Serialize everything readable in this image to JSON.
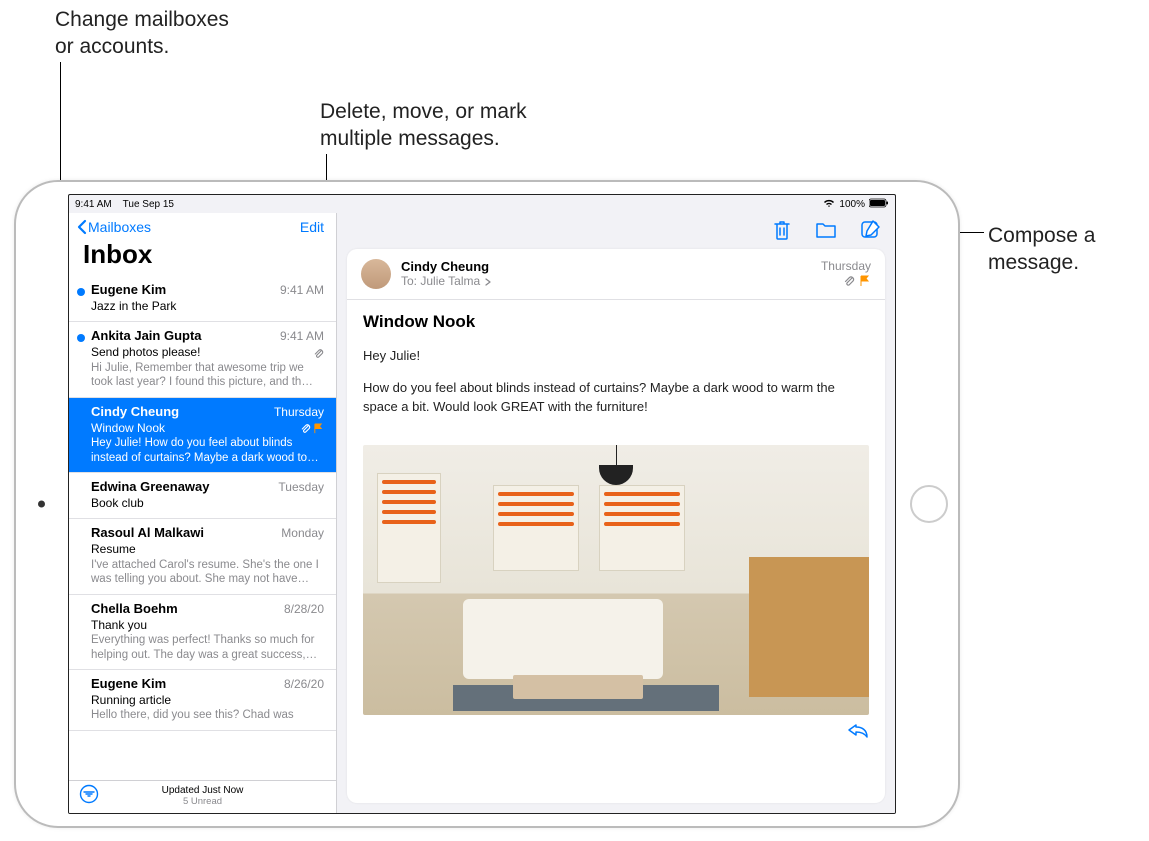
{
  "callouts": {
    "mailboxes": "Change mailboxes\nor accounts.",
    "edit": "Delete, move, or mark\nmultiple messages.",
    "compose": "Compose a\nmessage."
  },
  "status": {
    "time": "9:41 AM",
    "date": "Tue Sep 15",
    "wifi": "wifi",
    "battery_pct": "100%"
  },
  "sidebar": {
    "back_label": "Mailboxes",
    "edit_label": "Edit",
    "title": "Inbox",
    "items": [
      {
        "sender": "Eugene Kim",
        "date": "9:41 AM",
        "subject": "Jazz in the Park",
        "preview": "",
        "unread": true,
        "attachment": false,
        "flagged": false,
        "selected": false
      },
      {
        "sender": "Ankita Jain Gupta",
        "date": "9:41 AM",
        "subject": "Send photos please!",
        "preview": "Hi Julie, Remember that awesome trip we took last year? I found this picture, and th…",
        "unread": true,
        "attachment": true,
        "flagged": false,
        "selected": false
      },
      {
        "sender": "Cindy Cheung",
        "date": "Thursday",
        "subject": "Window Nook",
        "preview": "Hey Julie! How do you feel about blinds instead of curtains? Maybe a dark wood to…",
        "unread": false,
        "attachment": true,
        "flagged": true,
        "selected": true
      },
      {
        "sender": "Edwina Greenaway",
        "date": "Tuesday",
        "subject": "Book club",
        "preview": "",
        "unread": false,
        "attachment": false,
        "flagged": false,
        "selected": false
      },
      {
        "sender": "Rasoul Al Malkawi",
        "date": "Monday",
        "subject": "Resume",
        "preview": "I've attached Carol's resume. She's the one I was telling you about. She may not have…",
        "unread": false,
        "attachment": false,
        "flagged": false,
        "selected": false
      },
      {
        "sender": "Chella Boehm",
        "date": "8/28/20",
        "subject": "Thank you",
        "preview": "Everything was perfect! Thanks so much for helping out. The day was a great success,…",
        "unread": false,
        "attachment": false,
        "flagged": false,
        "selected": false
      },
      {
        "sender": "Eugene Kim",
        "date": "8/26/20",
        "subject": "Running article",
        "preview": "Hello there, did you see this? Chad was",
        "unread": false,
        "attachment": false,
        "flagged": false,
        "selected": false
      }
    ],
    "footer_status": "Updated Just Now",
    "footer_unread": "5 Unread"
  },
  "detail": {
    "from": "Cindy Cheung",
    "to_label": "To:",
    "to_name": "Julie Talma",
    "date": "Thursday",
    "attachment": true,
    "flagged": true,
    "subject": "Window Nook",
    "greeting": "Hey Julie!",
    "body": "How do you feel about blinds instead of curtains? Maybe a dark wood to warm the space a bit. Would look GREAT with the furniture!"
  },
  "icons": {
    "delete": "trash-icon",
    "move": "folder-icon",
    "compose": "compose-icon",
    "reply": "reply-icon",
    "filter": "filter-icon",
    "attachment": "paperclip-icon",
    "flag": "flag-icon"
  }
}
